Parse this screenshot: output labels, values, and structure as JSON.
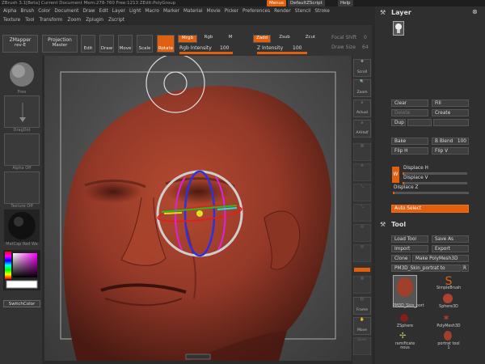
{
  "titlebar": {
    "left": "ZBrush   3.1[Beta]   Current Document   Mem:278-760 Free:1213 ZEdit:PolyGroup",
    "menus_btn": "Menus",
    "script_btn": "DefaultZScript",
    "help_btn": "Help"
  },
  "menubar": [
    "Alpha",
    "Brush",
    "Color",
    "Document",
    "Draw",
    "Edit",
    "Layer",
    "Light",
    "Macro",
    "Marker",
    "Material",
    "Movie",
    "Picker",
    "Preferences",
    "Render",
    "Stencil",
    "Stroke"
  ],
  "menubar2": [
    "Texture",
    "Tool",
    "Transform",
    "Zoom",
    "Zplugin",
    "Zscript"
  ],
  "toolbar": {
    "zmapper": "ZMapper",
    "zmapper_rev": "rev-E",
    "projection": "Projection",
    "projection2": "Master",
    "edit": "Edit",
    "draw": "Draw",
    "move": "Move",
    "scale": "Scale",
    "rotate": "Rotate",
    "mrgb": "Mrgb",
    "rgb": "Rgb",
    "m": "M",
    "rgb_intensity_label": "Rgb Intensity",
    "rgb_intensity": "100",
    "zadd": "Zadd",
    "zsub": "Zsub",
    "zcut": "Zcut",
    "z_intensity_label": "Z Intensity",
    "z_intensity": "100",
    "focal_label": "Focal Shift",
    "focal": "0",
    "draw_size_label": "Draw Size",
    "draw_size": "64"
  },
  "left": {
    "brush_cap": "Free",
    "stroke_cap": "DragDot",
    "alpha_cap": "Alpha Off",
    "texture_cap": "Texture Off",
    "material_cap": "MatCap Red Wa",
    "switch_color": "SwitchColor"
  },
  "shelf": [
    "Scroll",
    "Zoom",
    "Actual",
    "AAHalf",
    "",
    "",
    "",
    "",
    "",
    "",
    "",
    "",
    "",
    "Frame",
    "Move",
    "Scale",
    "Rotate"
  ],
  "layer_panel": {
    "title": "Layer",
    "clear": "Clear",
    "fill": "Fill",
    "delete": "Delete",
    "create": "Create",
    "dup": "Dup",
    "bake": "Bake",
    "b_blend_label": "B Blend",
    "b_blend": "100",
    "flip_h": "Flip H",
    "flip_v": "Flip V",
    "w_label": "W",
    "displace_h": "Displace H",
    "displace_v": "Displace V",
    "displace_z": "Displace Z",
    "auto_select": "Auto Select"
  },
  "tool_panel": {
    "title": "Tool",
    "load": "Load Tool",
    "save": "Save As",
    "import": "Import",
    "export": "Export",
    "clone": "Clone",
    "make_polymesh": "Make PolyMesh3D",
    "current_tool": "PM3D_Skin_portrat to",
    "r_btn": "R",
    "tiles": [
      "PM3D_Skin_port",
      "SimpleBrush",
      "Sphere3D",
      "ZSphere",
      "PolyMesh3D",
      "ramificate nous",
      "portrat tool 1"
    ]
  },
  "colors": {
    "accent": "#e06010",
    "head_skin": "#a0402a"
  }
}
